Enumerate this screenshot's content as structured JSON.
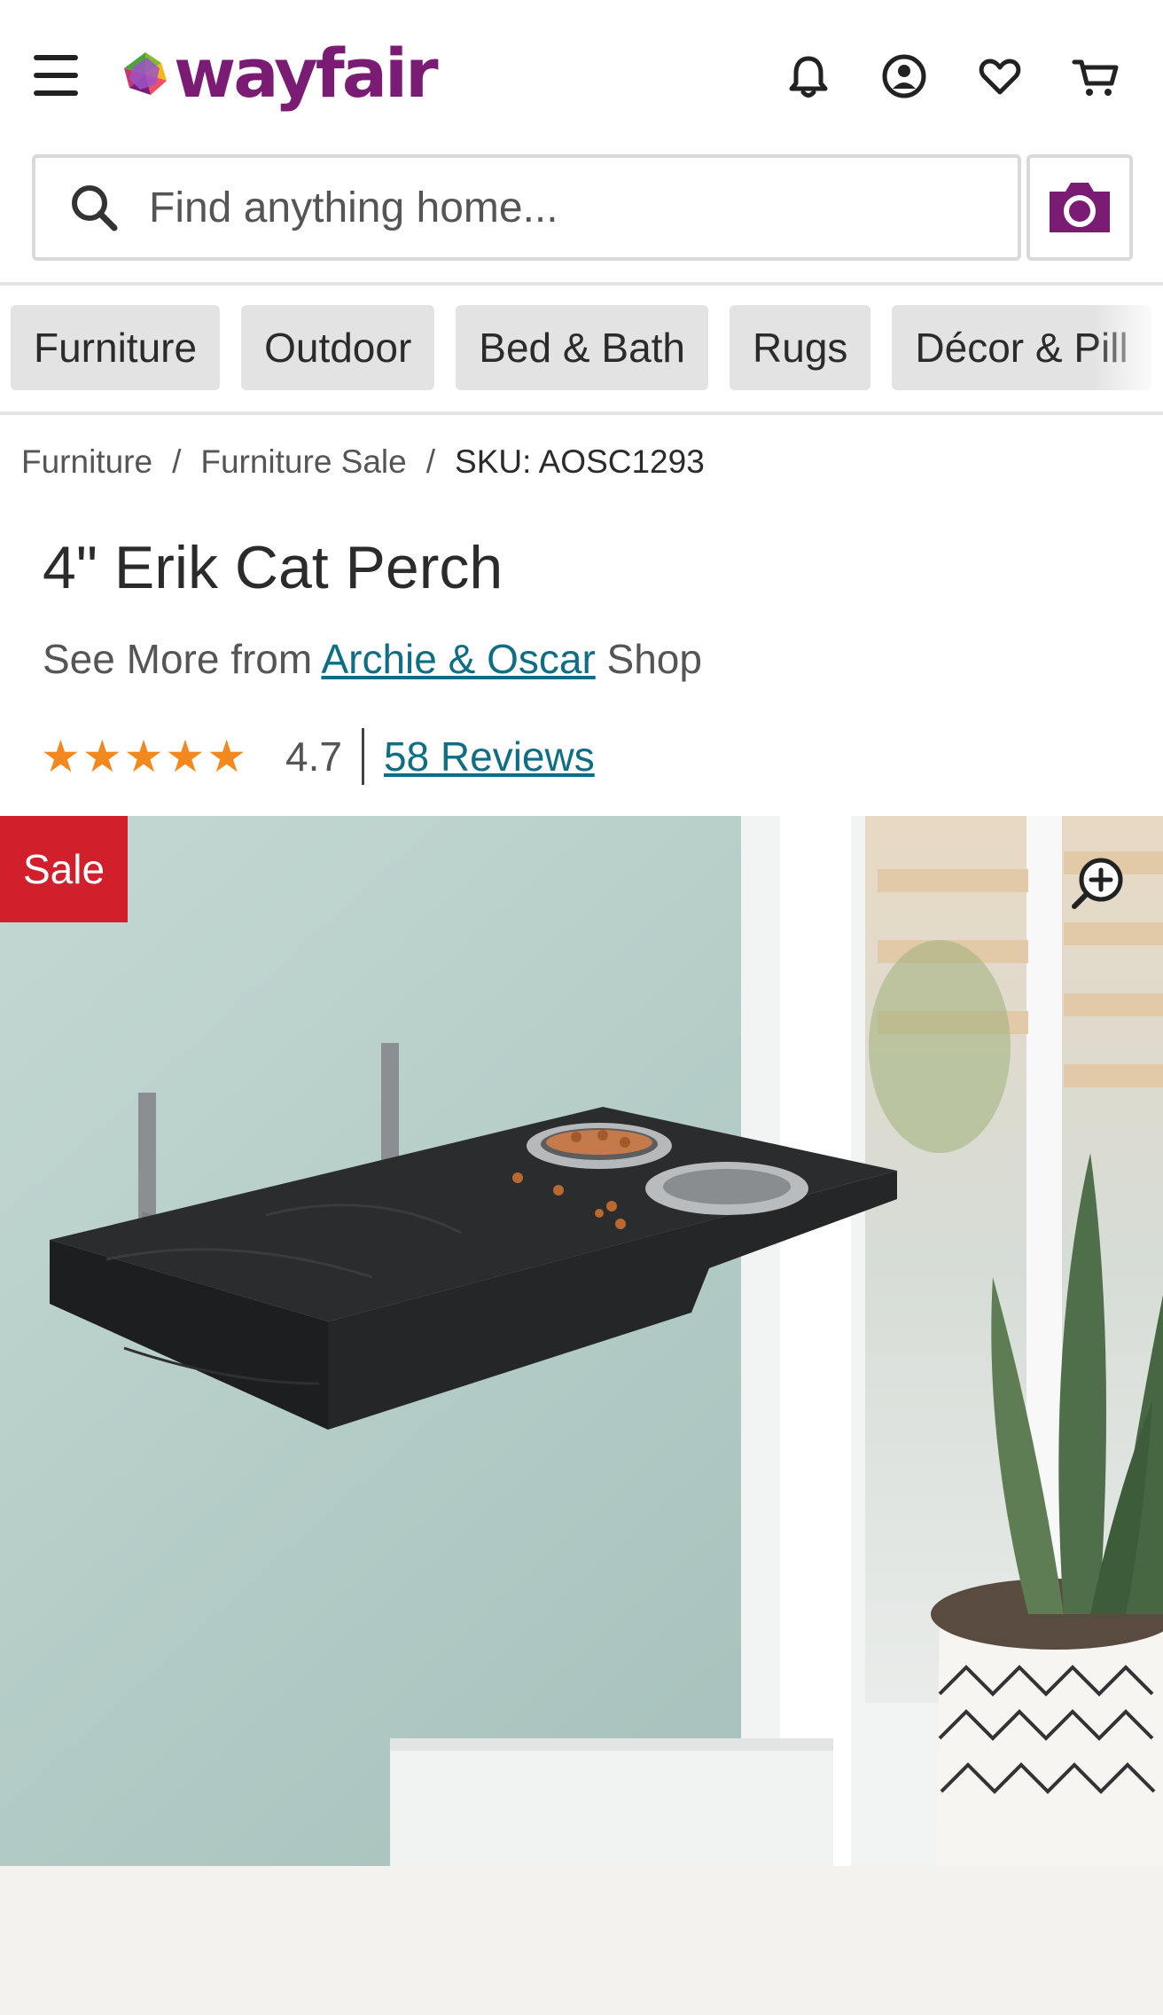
{
  "header": {
    "logo_text": "wayfair",
    "icons": [
      "hamburger-menu-icon",
      "bell-icon",
      "account-icon",
      "heart-icon",
      "cart-icon"
    ]
  },
  "search": {
    "placeholder": "Find anything home...",
    "camera_icon": "camera-icon"
  },
  "categories": [
    "Furniture",
    "Outdoor",
    "Bed & Bath",
    "Rugs",
    "Décor & Pill"
  ],
  "breadcrumb": {
    "items": [
      "Furniture",
      "Furniture Sale"
    ],
    "separator": "/",
    "current": "SKU: AOSC1293"
  },
  "product": {
    "title": "4\" Erik Cat Perch",
    "see_more_prefix": "See More from ",
    "brand_link": "Archie & Oscar",
    "see_more_suffix": " Shop",
    "rating": 4.7,
    "rating_text": "4.7",
    "reviews_link": "58 Reviews",
    "sale_badge": "Sale"
  },
  "colors": {
    "brand_purple": "#7b1c74",
    "link_teal": "#0f6e84",
    "star_orange": "#f3891e",
    "sale_red": "#d1202b"
  }
}
